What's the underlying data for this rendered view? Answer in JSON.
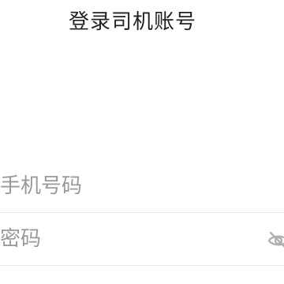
{
  "header": {
    "title": "登录司机账号"
  },
  "form": {
    "phone": {
      "placeholder": "手机号码",
      "value": ""
    },
    "password": {
      "placeholder": "密码",
      "value": "",
      "visibility_icon": "eye-off-icon"
    }
  },
  "colors": {
    "text": "#222222",
    "placeholder": "#9a9a9a",
    "divider": "#e8e8e8",
    "icon": "#b0b0b0"
  }
}
